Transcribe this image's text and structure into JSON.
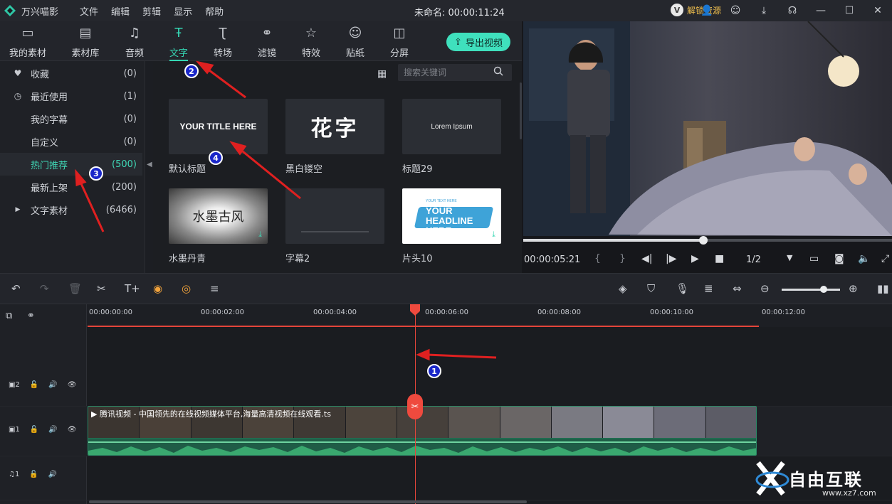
{
  "app": {
    "name": "万兴喵影",
    "doc_title": "未命名: 00:00:11:24",
    "menus": [
      "文件",
      "编辑",
      "剪辑",
      "显示",
      "帮助"
    ],
    "unlock_label": "解锁资源"
  },
  "tabs": [
    {
      "label": "我的素材",
      "icon": "folder-icon"
    },
    {
      "label": "素材库",
      "icon": "library-icon"
    },
    {
      "label": "音频",
      "icon": "music-icon"
    },
    {
      "label": "文字",
      "icon": "text-icon",
      "active": true
    },
    {
      "label": "转场",
      "icon": "transition-icon"
    },
    {
      "label": "滤镜",
      "icon": "filter-icon"
    },
    {
      "label": "特效",
      "icon": "effect-icon"
    },
    {
      "label": "贴纸",
      "icon": "sticker-icon"
    },
    {
      "label": "分屏",
      "icon": "splitscreen-icon"
    }
  ],
  "export_label": "导出视频",
  "categories": [
    {
      "label": "收藏",
      "count": "(0)"
    },
    {
      "label": "最近使用",
      "count": "(1)"
    },
    {
      "label": "我的字幕",
      "count": "(0)"
    },
    {
      "label": "自定义",
      "count": "(0)"
    },
    {
      "label": "热门推荐",
      "count": "(500)",
      "active": true
    },
    {
      "label": "最新上架",
      "count": "(200)"
    },
    {
      "label": "文字素材",
      "count": "(6466)"
    }
  ],
  "search": {
    "placeholder": "搜索关键词"
  },
  "library": [
    {
      "caption": "默认标题",
      "thumb_text": "YOUR TITLE HERE"
    },
    {
      "caption": "黑白镂空",
      "thumb_text": "花字"
    },
    {
      "caption": "标题29",
      "thumb_text": "Lorem Ipsum"
    },
    {
      "caption": "水墨丹青",
      "thumb_text": "水墨古风"
    },
    {
      "caption": "字幕2",
      "thumb_text": ""
    },
    {
      "caption": "片头10",
      "thumb_text": "YOUR HEADLINE HERE",
      "thumb_small": "YOUR TEXT HERE"
    }
  ],
  "preview": {
    "timecode": "00:00:05:21",
    "page": "1/2",
    "progress_fraction": 0.486
  },
  "timeline": {
    "ticks": [
      "00:00:00:00",
      "00:00:02:00",
      "00:00:04:00",
      "00:00:06:00",
      "00:00:08:00",
      "00:00:10:00",
      "00:00:12:00"
    ],
    "tracks": [
      {
        "label": "2",
        "kind": "video"
      },
      {
        "label": "1",
        "kind": "video"
      },
      {
        "label": "1",
        "kind": "audio"
      }
    ],
    "clip_title": "腾讯视频 - 中国领先的在线视频媒体平台,海量高清视频在线观看.ts"
  },
  "annotations": [
    "1",
    "2",
    "3",
    "4"
  ],
  "watermark": {
    "main": "自由互联",
    "sub": "www.xz7.com"
  },
  "colors": {
    "accent": "#35d6b3",
    "playhead": "#e4453a",
    "badge": "#1a27c9",
    "clip": "#1f6b4f"
  }
}
